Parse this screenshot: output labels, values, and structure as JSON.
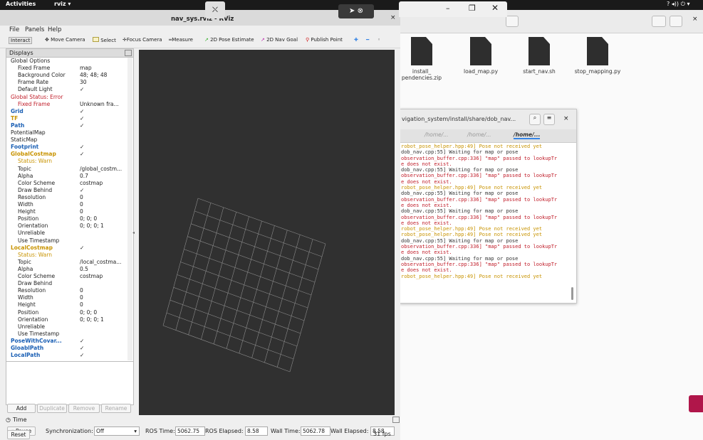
{
  "topbar": {
    "activities": "Activities",
    "app": "rviz",
    "indicators": "? ◂)) ⏻ ▾"
  },
  "file_manager": {
    "files": [
      {
        "name": "install_\npendencies.zip"
      },
      {
        "name": "load_map.py"
      },
      {
        "name": "start_nav.sh"
      },
      {
        "name": "stop_mapping.py"
      }
    ]
  },
  "terminal": {
    "title": "vigation_system/install/share/dob_nav...",
    "tabs": [
      "/home/...",
      "/home/...",
      "/home/..."
    ],
    "lines": [
      {
        "c": "y",
        "t": "robot_pose_helper.hpp:49] Pose not received yet"
      },
      {
        "c": "k",
        "t": "dob_nav.cpp:55] Waiting for map or pose"
      },
      {
        "c": "r",
        "t": "observation_buffer.cpp:336] \"map\" passed to lookupTr"
      },
      {
        "c": "r",
        "t": "e does not exist."
      },
      {
        "c": "k",
        "t": "dob_nav.cpp:55] Waiting for map or pose"
      },
      {
        "c": "r",
        "t": "observation_buffer.cpp:336] \"map\" passed to lookupTr"
      },
      {
        "c": "r",
        "t": "e does not exist."
      },
      {
        "c": "y",
        "t": "robot_pose_helper.hpp:49] Pose not received yet"
      },
      {
        "c": "k",
        "t": "dob_nav.cpp:55] Waiting for map or pose"
      },
      {
        "c": "r",
        "t": "observation_buffer.cpp:336] \"map\" passed to lookupTr"
      },
      {
        "c": "r",
        "t": "e does not exist."
      },
      {
        "c": "k",
        "t": "dob_nav.cpp:55] Waiting for map or pose"
      },
      {
        "c": "r",
        "t": "observation_buffer.cpp:336] \"map\" passed to lookupTr"
      },
      {
        "c": "r",
        "t": "e does not exist."
      },
      {
        "c": "y",
        "t": "robot_pose_helper.hpp:49] Pose not received yet"
      },
      {
        "c": "y",
        "t": "robot_pose_helper.hpp:49] Pose not received yet"
      },
      {
        "c": "k",
        "t": "dob_nav.cpp:55] Waiting for map or pose"
      },
      {
        "c": "r",
        "t": "observation_buffer.cpp:336] \"map\" passed to lookupTr"
      },
      {
        "c": "r",
        "t": "e does not exist."
      },
      {
        "c": "k",
        "t": "dob_nav.cpp:55] Waiting for map or pose"
      },
      {
        "c": "r",
        "t": "observation_buffer.cpp:336] \"map\" passed to lookupTr"
      },
      {
        "c": "r",
        "t": "e does not exist."
      },
      {
        "c": "y",
        "t": "robot_pose_helper.hpp:49] Pose not received yet"
      }
    ]
  },
  "rviz": {
    "title": "nav_sys.rviz - RViz",
    "menu": [
      "File",
      "Panels",
      "Help"
    ],
    "tools": [
      "Interact",
      "Move Camera",
      "Select",
      "Focus Camera",
      "Measure",
      "2D Pose Estimate",
      "2D Nav Goal",
      "Publish Point"
    ],
    "displays_title": "Displays",
    "tree": [
      {
        "k": "Global Options",
        "v": "",
        "indent": 1,
        "color": "#222"
      },
      {
        "k": "Fixed Frame",
        "v": "map",
        "indent": 2,
        "color": "#222"
      },
      {
        "k": "Background Color",
        "v": "48; 48; 48",
        "indent": 2,
        "color": "#222"
      },
      {
        "k": "Frame Rate",
        "v": "30",
        "indent": 2,
        "color": "#222"
      },
      {
        "k": "Default Light",
        "v": "✓",
        "indent": 2,
        "color": "#222"
      },
      {
        "k": "Global Status: Error",
        "v": "",
        "indent": 1,
        "color": "#c01c28"
      },
      {
        "k": "Fixed Frame",
        "v": "Unknown fra...",
        "indent": 2,
        "color": "#c01c28"
      },
      {
        "k": "Grid",
        "v": "✓",
        "indent": 1,
        "color": "#1a5fb4",
        "b": true
      },
      {
        "k": "TF",
        "v": "✓",
        "indent": 1,
        "color": "#c89300",
        "b": true
      },
      {
        "k": "Path",
        "v": "✓",
        "indent": 1,
        "color": "#1a5fb4",
        "b": true
      },
      {
        "k": "PotentialMap",
        "v": "",
        "indent": 1,
        "color": "#222"
      },
      {
        "k": "StaticMap",
        "v": "",
        "indent": 1,
        "color": "#222"
      },
      {
        "k": "Footprint",
        "v": "✓",
        "indent": 1,
        "color": "#1a5fb4",
        "b": true
      },
      {
        "k": "GlobalCostmap",
        "v": "✓",
        "indent": 1,
        "color": "#c89300",
        "b": true
      },
      {
        "k": "Status: Warn",
        "v": "",
        "indent": 2,
        "color": "#c89300"
      },
      {
        "k": "Topic",
        "v": "/global_costm...",
        "indent": 2,
        "color": "#222"
      },
      {
        "k": "Alpha",
        "v": "0.7",
        "indent": 2,
        "color": "#222"
      },
      {
        "k": "Color Scheme",
        "v": "costmap",
        "indent": 2,
        "color": "#222"
      },
      {
        "k": "Draw Behind",
        "v": "✓",
        "indent": 2,
        "color": "#222"
      },
      {
        "k": "Resolution",
        "v": "0",
        "indent": 2,
        "color": "#222"
      },
      {
        "k": "Width",
        "v": "0",
        "indent": 2,
        "color": "#222"
      },
      {
        "k": "Height",
        "v": "0",
        "indent": 2,
        "color": "#222"
      },
      {
        "k": "Position",
        "v": "0; 0; 0",
        "indent": 2,
        "color": "#222"
      },
      {
        "k": "Orientation",
        "v": "0; 0; 0; 1",
        "indent": 2,
        "color": "#222"
      },
      {
        "k": "Unreliable",
        "v": "",
        "indent": 2,
        "color": "#222"
      },
      {
        "k": "Use Timestamp",
        "v": "",
        "indent": 2,
        "color": "#222"
      },
      {
        "k": "LocalCostmap",
        "v": "✓",
        "indent": 1,
        "color": "#c89300",
        "b": true
      },
      {
        "k": "Status: Warn",
        "v": "",
        "indent": 2,
        "color": "#c89300"
      },
      {
        "k": "Topic",
        "v": "/local_costma...",
        "indent": 2,
        "color": "#222"
      },
      {
        "k": "Alpha",
        "v": "0.5",
        "indent": 2,
        "color": "#222"
      },
      {
        "k": "Color Scheme",
        "v": "costmap",
        "indent": 2,
        "color": "#222"
      },
      {
        "k": "Draw Behind",
        "v": "",
        "indent": 2,
        "color": "#222"
      },
      {
        "k": "Resolution",
        "v": "0",
        "indent": 2,
        "color": "#222"
      },
      {
        "k": "Width",
        "v": "0",
        "indent": 2,
        "color": "#222"
      },
      {
        "k": "Height",
        "v": "0",
        "indent": 2,
        "color": "#222"
      },
      {
        "k": "Position",
        "v": "0; 0; 0",
        "indent": 2,
        "color": "#222"
      },
      {
        "k": "Orientation",
        "v": "0; 0; 0; 1",
        "indent": 2,
        "color": "#222"
      },
      {
        "k": "Unreliable",
        "v": "",
        "indent": 2,
        "color": "#222"
      },
      {
        "k": "Use Timestamp",
        "v": "",
        "indent": 2,
        "color": "#222"
      },
      {
        "k": "PoseWithCovar...",
        "v": "✓",
        "indent": 1,
        "color": "#1a5fb4",
        "b": true
      },
      {
        "k": "GloablPath",
        "v": "✓",
        "indent": 1,
        "color": "#1a5fb4",
        "b": true
      },
      {
        "k": "LocalPath",
        "v": "✓",
        "indent": 1,
        "color": "#1a5fb4",
        "b": true
      }
    ],
    "buttons": [
      "Add",
      "Duplicate",
      "Remove",
      "Rename"
    ],
    "time_panel": "Time",
    "pause": "Pause",
    "sync_label": "Synchronization:",
    "sync_value": "Off",
    "ros_time_label": "ROS Time:",
    "ros_time": "5062.75",
    "ros_elapsed_label": "ROS Elapsed:",
    "ros_elapsed": "8.58",
    "wall_time_label": "Wall Time:",
    "wall_time": "5062.78",
    "wall_elapsed_label": "Wall Elapsed:",
    "wall_elapsed": "8.58",
    "reset": "Reset",
    "fps": "31 fps"
  }
}
